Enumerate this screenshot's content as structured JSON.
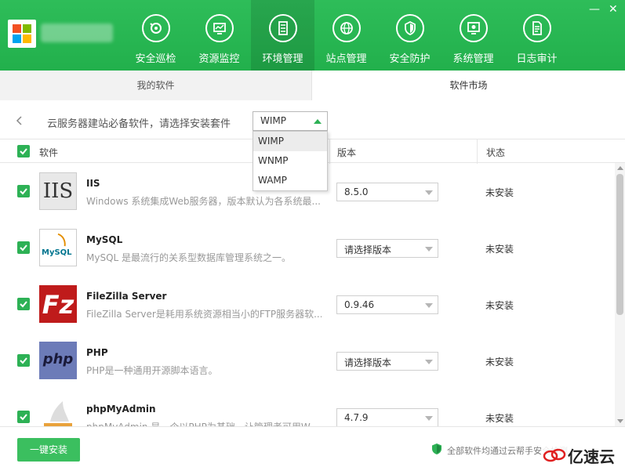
{
  "header": {
    "nav": [
      {
        "label": "安全巡检",
        "icon": "scan-icon"
      },
      {
        "label": "资源监控",
        "icon": "monitor-icon"
      },
      {
        "label": "环境管理",
        "icon": "server-icon",
        "active": true
      },
      {
        "label": "站点管理",
        "icon": "globe-icon"
      },
      {
        "label": "安全防护",
        "icon": "shield-icon"
      },
      {
        "label": "系统管理",
        "icon": "settings-monitor-icon"
      },
      {
        "label": "日志审计",
        "icon": "document-icon"
      }
    ],
    "minimize": "—",
    "close": "✕"
  },
  "tabs": {
    "mine": "我的软件",
    "market": "软件市场"
  },
  "filter": {
    "label": "云服务器建站必备软件，请选择安装套件",
    "selected": "WIMP",
    "options": [
      "WIMP",
      "WNMP",
      "WAMP"
    ]
  },
  "table": {
    "headers": {
      "name": "软件",
      "version": "版本",
      "status": "状态"
    },
    "rows": [
      {
        "name": "IIS",
        "icon_text": "IIS",
        "desc": "Windows 系统集成Web服务器，版本默认为各系统最...",
        "version": "8.5.0",
        "status": "未安装"
      },
      {
        "name": "MySQL",
        "icon_text": "MySQL",
        "desc": "MySQL 是最流行的关系型数据库管理系统之一。",
        "version": "请选择版本",
        "status": "未安装"
      },
      {
        "name": "FileZilla Server",
        "icon_text": "Fz",
        "desc": "FileZilla Server是耗用系统资源相当小的FTP服务器软...",
        "version": "0.9.46",
        "status": "未安装"
      },
      {
        "name": "PHP",
        "icon_text": "php",
        "desc": "PHP是一种通用开源脚本语言。",
        "version": "请选择版本",
        "status": "未安装"
      },
      {
        "name": "phpMyAdmin",
        "icon_text": "",
        "desc": "phpMyAdmin 是一个以PHP为基础，让管理者可用W...",
        "version": "4.7.9",
        "status": "未安装"
      }
    ]
  },
  "footer": {
    "install": "一键安装",
    "note": "全部软件均通过云帮手安全检测"
  },
  "watermark": {
    "text": "亿速云"
  },
  "colors": {
    "brand": "#22b04c",
    "accent": "#2db155"
  }
}
